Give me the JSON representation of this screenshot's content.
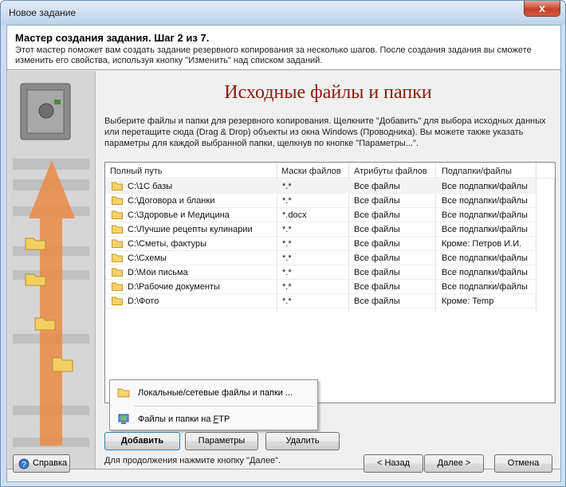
{
  "window": {
    "title": "Новое задание",
    "close_label": "x"
  },
  "header": {
    "title": "Мастер создания задания.  Шаг 2 из 7.",
    "description": "Этот мастер поможет вам создать задание резервного копирования за несколько шагов. После создания задания вы сможете изменить его свойства, используя кнопку \"Изменить\" над списком заданий."
  },
  "main": {
    "page_title": "Исходные файлы и папки",
    "intro": "Выберите файлы и папки для резервного копирования. Щелкните \"Добавить\" для выбора исходных данных или перетащите сюда (Drag & Drop) объекты из окна Windows (Проводника). Вы можете также указать параметры для каждой выбранной папки, щелкнув по кнопке \"Параметры...\".",
    "columns": [
      "Полный путь",
      "Маски файлов",
      "Атрибуты файлов",
      "Подпапки/файлы"
    ],
    "rows": [
      {
        "path": "C:\\1С базы",
        "mask": "*.*",
        "attrs": "Все файлы",
        "sub": "Все подпапки/файлы"
      },
      {
        "path": "C:\\Договора и бланки",
        "mask": "*.*",
        "attrs": "Все файлы",
        "sub": "Все подпапки/файлы"
      },
      {
        "path": "C:\\Здоровье и Медицина",
        "mask": "*.docx",
        "attrs": "Все файлы",
        "sub": "Все подпапки/файлы"
      },
      {
        "path": "C:\\Лучшие рецепты кулинарии",
        "mask": "*.*",
        "attrs": "Все файлы",
        "sub": "Все подпапки/файлы"
      },
      {
        "path": "C:\\Сметы, фактуры",
        "mask": "*.*",
        "attrs": "Все файлы",
        "sub": "Кроме: Петров И.И."
      },
      {
        "path": "C:\\Схемы",
        "mask": "*.*",
        "attrs": "Все файлы",
        "sub": "Все подпапки/файлы"
      },
      {
        "path": "D:\\Мои письма",
        "mask": "*.*",
        "attrs": "Все файлы",
        "sub": "Все подпапки/файлы"
      },
      {
        "path": "D:\\Рабочие документы",
        "mask": "*.*",
        "attrs": "Все файлы",
        "sub": "Все подпапки/файлы"
      },
      {
        "path": "D:\\Фото",
        "mask": "*.*",
        "attrs": "Все файлы",
        "sub": "Кроме: Temp"
      }
    ],
    "popup": {
      "local_label": "Локальные/сетевые файлы и папки ...",
      "ftp_label_pre": "Файлы и папки на ",
      "ftp_label_accel": "F",
      "ftp_label_post": "TP"
    },
    "buttons": {
      "add": "Добавить",
      "params": "Параметры",
      "delete": "Удалить"
    },
    "hint": "Для продолжения нажмите кнопку \"Далее\"."
  },
  "footer": {
    "help": "Справка",
    "back": "< Назад",
    "next": "Далее >",
    "cancel": "Отмена"
  },
  "colors": {
    "accent_title": "#8b1a0e",
    "arrow": "#e8843a"
  }
}
